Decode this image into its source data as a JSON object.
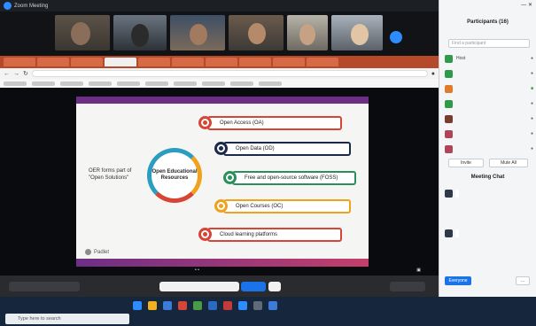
{
  "window": {
    "title": "Zoom Meeting"
  },
  "slide": {
    "left_label": "OER forms part of \"Open Solutions\"",
    "circle_label": "Open Educational Resources",
    "items": [
      {
        "label": "Open Access (OA)",
        "color": "#d64536"
      },
      {
        "label": "Open Data (OD)",
        "color": "#1c2a4a"
      },
      {
        "label": "Free and open-source software (FOSS)",
        "color": "#2a8f5a"
      },
      {
        "label": "Open Courses (OC)",
        "color": "#f0a21f"
      },
      {
        "label": "Cloud learning platforms",
        "color": "#d64536"
      }
    ],
    "footer": "Padlet"
  },
  "panel": {
    "title": "Participants (16)",
    "search_placeholder": "Find a participant",
    "participants": [
      {
        "name": "Host",
        "color": "#2e9a4a"
      },
      {
        "name": "",
        "color": "#2e9a4a"
      },
      {
        "name": "",
        "color": "#e07a2c"
      },
      {
        "name": "",
        "color": "#2e9a4a"
      },
      {
        "name": "",
        "color": "#7a3b2e"
      },
      {
        "name": "",
        "color": "#b0455a"
      },
      {
        "name": "",
        "color": "#b0455a"
      }
    ],
    "invite_label": "Invite",
    "mute_label": "Mute All",
    "chat_title": "Meeting Chat",
    "messages": [
      {
        "from": "",
        "text": ""
      },
      {
        "from": "",
        "text": ""
      }
    ],
    "send_label": "Everyone"
  },
  "taskbar": {
    "search_placeholder": "Type here to search",
    "clock": ""
  }
}
